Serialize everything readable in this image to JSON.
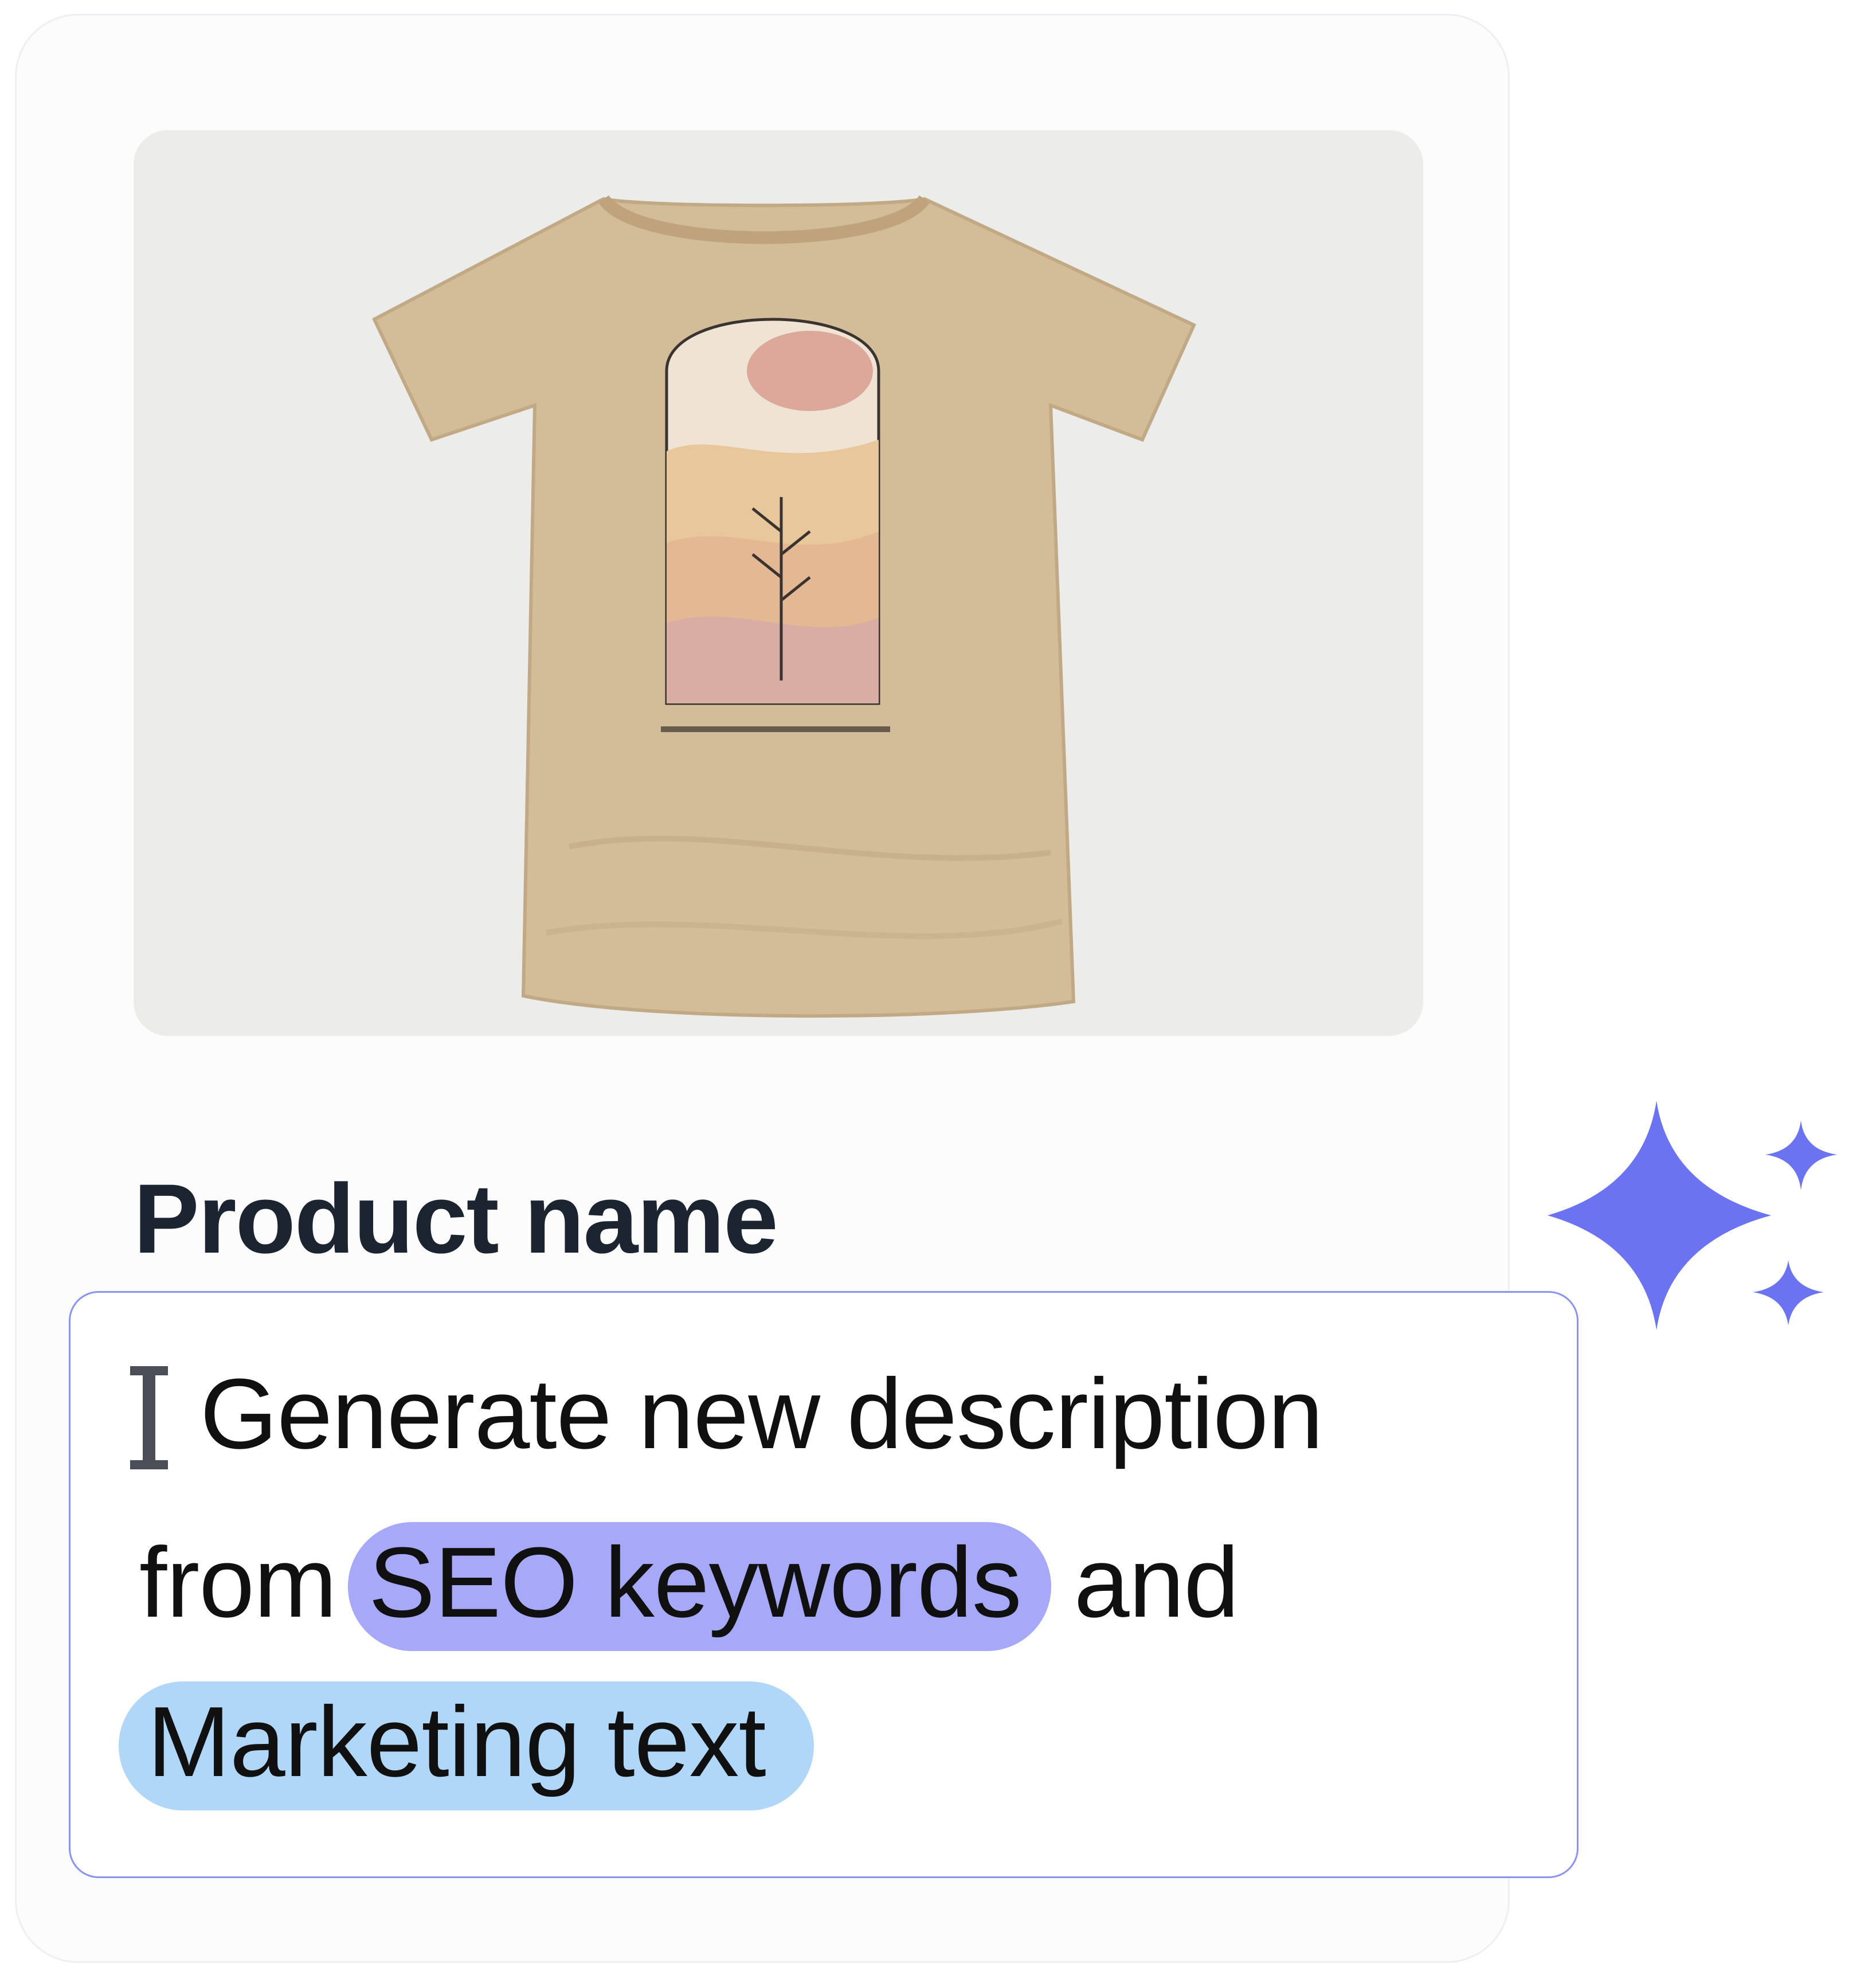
{
  "card": {
    "product_image": {
      "icon": "tshirt-product-photo",
      "colors": {
        "shirt": "#d3bc98",
        "background": "#ececea"
      }
    },
    "product_name_label": "Product name"
  },
  "prompt": {
    "line1": "Generate new description",
    "line2_prefix": "from",
    "chip_seo": "SEO keywords",
    "line2_suffix": "and",
    "chip_marketing": "Marketing text",
    "colors": {
      "chip_seo": "#a6a8f8",
      "chip_marketing": "#b0d6f8",
      "border": "#8a93ee"
    }
  },
  "decor": {
    "sparkle_icon": "sparkles-icon",
    "sparkle_color": "#6c73f0"
  }
}
